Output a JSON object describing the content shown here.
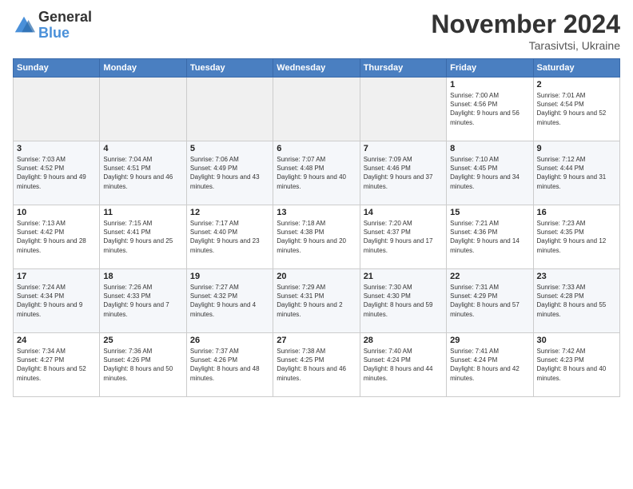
{
  "logo": {
    "general": "General",
    "blue": "Blue"
  },
  "header": {
    "month": "November 2024",
    "location": "Tarasivtsi, Ukraine"
  },
  "weekdays": [
    "Sunday",
    "Monday",
    "Tuesday",
    "Wednesday",
    "Thursday",
    "Friday",
    "Saturday"
  ],
  "weeks": [
    [
      {
        "day": "",
        "info": ""
      },
      {
        "day": "",
        "info": ""
      },
      {
        "day": "",
        "info": ""
      },
      {
        "day": "",
        "info": ""
      },
      {
        "day": "",
        "info": ""
      },
      {
        "day": "1",
        "info": "Sunrise: 7:00 AM\nSunset: 4:56 PM\nDaylight: 9 hours and 56 minutes."
      },
      {
        "day": "2",
        "info": "Sunrise: 7:01 AM\nSunset: 4:54 PM\nDaylight: 9 hours and 52 minutes."
      }
    ],
    [
      {
        "day": "3",
        "info": "Sunrise: 7:03 AM\nSunset: 4:52 PM\nDaylight: 9 hours and 49 minutes."
      },
      {
        "day": "4",
        "info": "Sunrise: 7:04 AM\nSunset: 4:51 PM\nDaylight: 9 hours and 46 minutes."
      },
      {
        "day": "5",
        "info": "Sunrise: 7:06 AM\nSunset: 4:49 PM\nDaylight: 9 hours and 43 minutes."
      },
      {
        "day": "6",
        "info": "Sunrise: 7:07 AM\nSunset: 4:48 PM\nDaylight: 9 hours and 40 minutes."
      },
      {
        "day": "7",
        "info": "Sunrise: 7:09 AM\nSunset: 4:46 PM\nDaylight: 9 hours and 37 minutes."
      },
      {
        "day": "8",
        "info": "Sunrise: 7:10 AM\nSunset: 4:45 PM\nDaylight: 9 hours and 34 minutes."
      },
      {
        "day": "9",
        "info": "Sunrise: 7:12 AM\nSunset: 4:44 PM\nDaylight: 9 hours and 31 minutes."
      }
    ],
    [
      {
        "day": "10",
        "info": "Sunrise: 7:13 AM\nSunset: 4:42 PM\nDaylight: 9 hours and 28 minutes."
      },
      {
        "day": "11",
        "info": "Sunrise: 7:15 AM\nSunset: 4:41 PM\nDaylight: 9 hours and 25 minutes."
      },
      {
        "day": "12",
        "info": "Sunrise: 7:17 AM\nSunset: 4:40 PM\nDaylight: 9 hours and 23 minutes."
      },
      {
        "day": "13",
        "info": "Sunrise: 7:18 AM\nSunset: 4:38 PM\nDaylight: 9 hours and 20 minutes."
      },
      {
        "day": "14",
        "info": "Sunrise: 7:20 AM\nSunset: 4:37 PM\nDaylight: 9 hours and 17 minutes."
      },
      {
        "day": "15",
        "info": "Sunrise: 7:21 AM\nSunset: 4:36 PM\nDaylight: 9 hours and 14 minutes."
      },
      {
        "day": "16",
        "info": "Sunrise: 7:23 AM\nSunset: 4:35 PM\nDaylight: 9 hours and 12 minutes."
      }
    ],
    [
      {
        "day": "17",
        "info": "Sunrise: 7:24 AM\nSunset: 4:34 PM\nDaylight: 9 hours and 9 minutes."
      },
      {
        "day": "18",
        "info": "Sunrise: 7:26 AM\nSunset: 4:33 PM\nDaylight: 9 hours and 7 minutes."
      },
      {
        "day": "19",
        "info": "Sunrise: 7:27 AM\nSunset: 4:32 PM\nDaylight: 9 hours and 4 minutes."
      },
      {
        "day": "20",
        "info": "Sunrise: 7:29 AM\nSunset: 4:31 PM\nDaylight: 9 hours and 2 minutes."
      },
      {
        "day": "21",
        "info": "Sunrise: 7:30 AM\nSunset: 4:30 PM\nDaylight: 8 hours and 59 minutes."
      },
      {
        "day": "22",
        "info": "Sunrise: 7:31 AM\nSunset: 4:29 PM\nDaylight: 8 hours and 57 minutes."
      },
      {
        "day": "23",
        "info": "Sunrise: 7:33 AM\nSunset: 4:28 PM\nDaylight: 8 hours and 55 minutes."
      }
    ],
    [
      {
        "day": "24",
        "info": "Sunrise: 7:34 AM\nSunset: 4:27 PM\nDaylight: 8 hours and 52 minutes."
      },
      {
        "day": "25",
        "info": "Sunrise: 7:36 AM\nSunset: 4:26 PM\nDaylight: 8 hours and 50 minutes."
      },
      {
        "day": "26",
        "info": "Sunrise: 7:37 AM\nSunset: 4:26 PM\nDaylight: 8 hours and 48 minutes."
      },
      {
        "day": "27",
        "info": "Sunrise: 7:38 AM\nSunset: 4:25 PM\nDaylight: 8 hours and 46 minutes."
      },
      {
        "day": "28",
        "info": "Sunrise: 7:40 AM\nSunset: 4:24 PM\nDaylight: 8 hours and 44 minutes."
      },
      {
        "day": "29",
        "info": "Sunrise: 7:41 AM\nSunset: 4:24 PM\nDaylight: 8 hours and 42 minutes."
      },
      {
        "day": "30",
        "info": "Sunrise: 7:42 AM\nSunset: 4:23 PM\nDaylight: 8 hours and 40 minutes."
      }
    ]
  ]
}
